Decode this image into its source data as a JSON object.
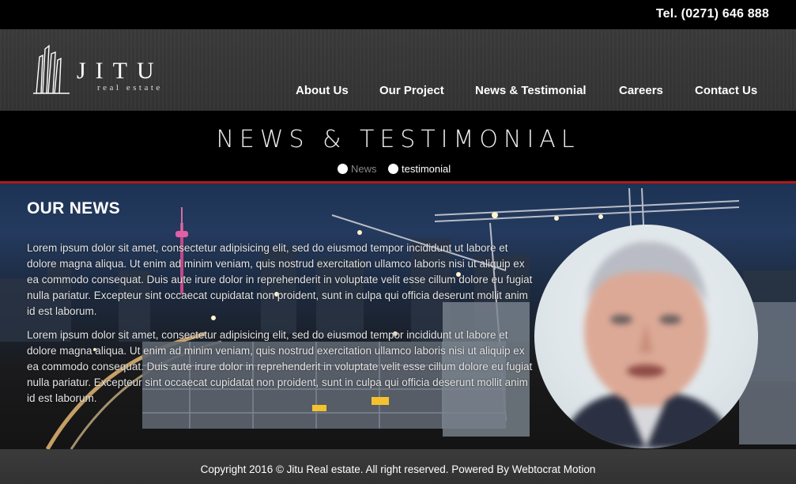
{
  "topbar": {
    "tel": "Tel. (0271) 646 888"
  },
  "brand": {
    "name": "JITU",
    "tagline": "real estate"
  },
  "nav": {
    "items": [
      {
        "label": "About Us"
      },
      {
        "label": "Our Project"
      },
      {
        "label": "News & Testimonial"
      },
      {
        "label": "Careers"
      },
      {
        "label": "Contact Us"
      }
    ]
  },
  "page": {
    "title": "NEWS & TESTIMONIAL",
    "tabs": [
      {
        "label": "News",
        "active": false
      },
      {
        "label": "testimonial",
        "active": true
      }
    ]
  },
  "news": {
    "heading": "OUR NEWS",
    "paragraphs": [
      "Lorem ipsum dolor sit amet, consectetur adipisicing elit, sed do eiusmod tempor incididunt ut labore et dolore magna aliqua. Ut enim ad minim veniam, quis nostrud exercitation ullamco laboris nisi ut aliquip ex ea commodo consequat. Duis aute irure dolor in reprehenderit in voluptate velit esse cillum dolore eu fugiat nulla pariatur. Excepteur sint occaecat cupidatat non proident, sunt in culpa qui officia deserunt mollit anim id est laborum.",
      "Lorem ipsum dolor sit amet, consectetur adipisicing elit, sed do eiusmod tempor incididunt ut labore et dolore magna aliqua. Ut enim ad minim veniam, quis nostrud exercitation ullamco laboris nisi ut aliquip ex ea commodo consequat. Duis aute irure dolor in reprehenderit in voluptate velit esse cillum dolore eu fugiat nulla pariatur. Excepteur sint occaecat cupidatat non proident, sunt in culpa qui officia deserunt mollit anim id est laborum."
    ]
  },
  "footer": {
    "copyright": "Copyright 2016 © Jitu Real estate. All right reserved. Powered By Webtocrat Motion"
  },
  "colors": {
    "accent_line": "#b01a1a",
    "header_bg": "#363636",
    "band_bg": "#000000"
  }
}
